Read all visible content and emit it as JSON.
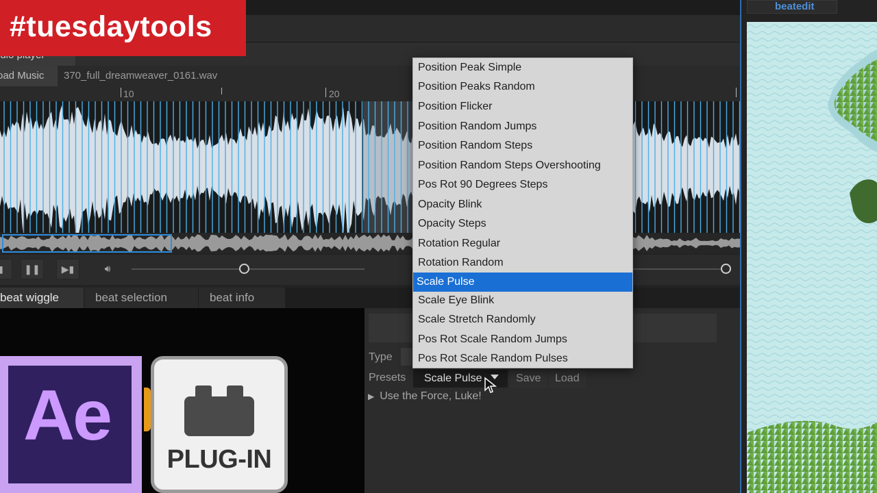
{
  "banner": {
    "text": "#tuesdaytools"
  },
  "panel": {
    "title": "udio player"
  },
  "file": {
    "load_label": "oad Music",
    "filename": "370_full_dreamweaver_0161.wav"
  },
  "ruler": {
    "labels": [
      "10",
      "20"
    ]
  },
  "transport": {
    "buttons": [
      "pause",
      "skip-forward",
      "volume"
    ],
    "position_fraction": 0.22,
    "volume_fraction": 1.0
  },
  "beat_tabs": [
    "beat wiggle",
    "beat selection",
    "beat info"
  ],
  "settings": {
    "type_label": "Type",
    "presets_label": "Presets",
    "preset_value": "Scale Pulse",
    "save_label": "Save",
    "load_label": "Load",
    "note": "Use the Force, Luke!"
  },
  "dropdown": {
    "selected": "Scale Pulse",
    "items": [
      "Position Peak Simple",
      "Position Peaks Random",
      "Position Flicker",
      "Position Random Jumps",
      "Position Random Steps",
      "Position Random Steps Overshooting",
      "Pos Rot 90 Degrees Steps",
      "Opacity Blink",
      "Opacity Steps",
      "Rotation Regular",
      "Rotation Random",
      "Scale Pulse",
      "Scale Eye Blink",
      "Scale Stretch Randomly",
      "Pos Rot Scale Random Jumps",
      "Pos Rot Scale Random Pulses"
    ]
  },
  "right_panel": {
    "tab": "beatedit"
  },
  "overlays": {
    "ae_text": "Ae",
    "plugin_text": "PLUG-IN"
  },
  "colors": {
    "accent": "#1a6fd4",
    "banner": "#d11f26",
    "ae_purple": "#30205f",
    "beat_marker": "#4ab0e8"
  }
}
